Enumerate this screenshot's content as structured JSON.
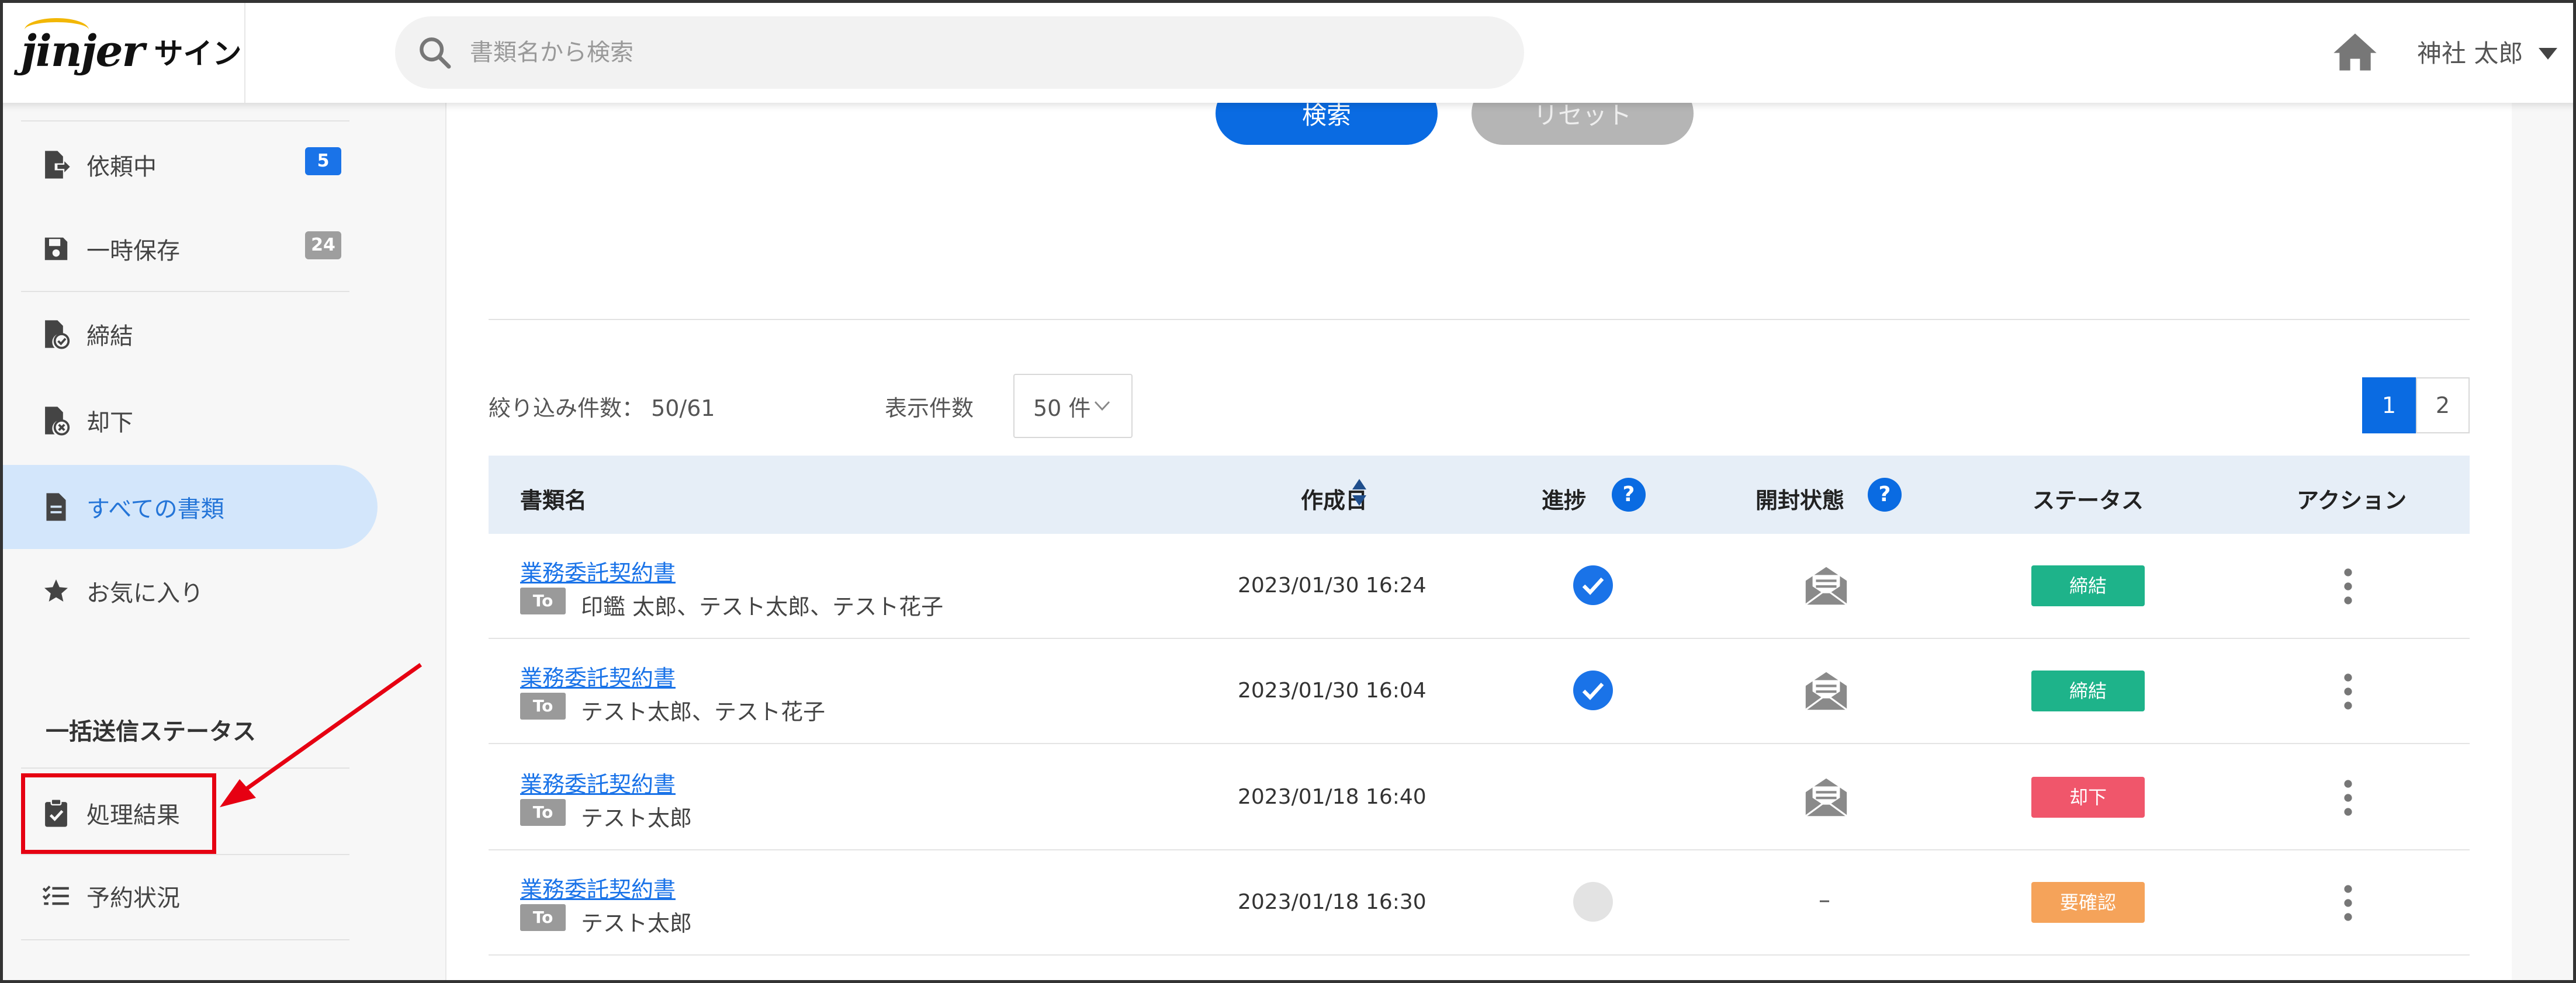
{
  "app": {
    "logo_text": "jinjer",
    "logo_sub": "サイン"
  },
  "header": {
    "search_placeholder": "書類名から検索",
    "user_name": "神社 太郎"
  },
  "sidebar": {
    "items": [
      {
        "label": "依頼中",
        "badge": "5",
        "badge_color": "#1a73e8",
        "icon": "file-export-icon"
      },
      {
        "label": "一時保存",
        "badge": "24",
        "badge_color": "#9e9e9e",
        "icon": "save-icon"
      },
      {
        "label": "締結",
        "icon": "file-check-icon"
      },
      {
        "label": "却下",
        "icon": "file-reject-icon"
      },
      {
        "label": "すべての書類",
        "icon": "document-icon",
        "active": true
      },
      {
        "label": "お気に入り",
        "icon": "star-icon"
      }
    ],
    "section_label": "一括送信ステータス",
    "bottom_items": [
      {
        "label": "処理結果",
        "icon": "clipboard-check-icon",
        "highlighted": true
      },
      {
        "label": "予約状況",
        "icon": "checklist-icon"
      }
    ]
  },
  "main": {
    "search_button": "検索",
    "reset_button": "リセット",
    "filter_count": "絞り込み件数： 50/61",
    "display_label": "表示件数",
    "display_value": "50 件",
    "pages": [
      "1",
      "2"
    ],
    "current_page": "1",
    "table": {
      "headers": {
        "name": "書類名",
        "created": "作成日",
        "progress": "進捗",
        "opened": "開封状態",
        "status": "ステータス",
        "action": "アクション"
      },
      "help_symbol": "?",
      "to_label": "To",
      "rows": [
        {
          "name": "業務委託契約書",
          "recipients": "印鑑 太郎、テスト太郎、テスト花子",
          "date": "2023/01/30 16:24",
          "progress": "done",
          "opened": "envelope",
          "status": "締結",
          "status_color": "#1eb38a"
        },
        {
          "name": "業務委託契約書",
          "recipients": "テスト太郎、テスト花子",
          "date": "2023/01/30 16:04",
          "progress": "done",
          "opened": "envelope",
          "status": "締結",
          "status_color": "#1eb38a"
        },
        {
          "name": "業務委託契約書",
          "recipients": "テスト太郎",
          "date": "2023/01/18 16:40",
          "progress": "none",
          "opened": "envelope",
          "status": "却下",
          "status_color": "#f0566b"
        },
        {
          "name": "業務委託契約書",
          "recipients": "テスト太郎",
          "date": "2023/01/18 16:30",
          "progress": "pending",
          "opened": "dash",
          "opened_text": "–",
          "status": "要確認",
          "status_color": "#f5a35a"
        }
      ]
    }
  }
}
